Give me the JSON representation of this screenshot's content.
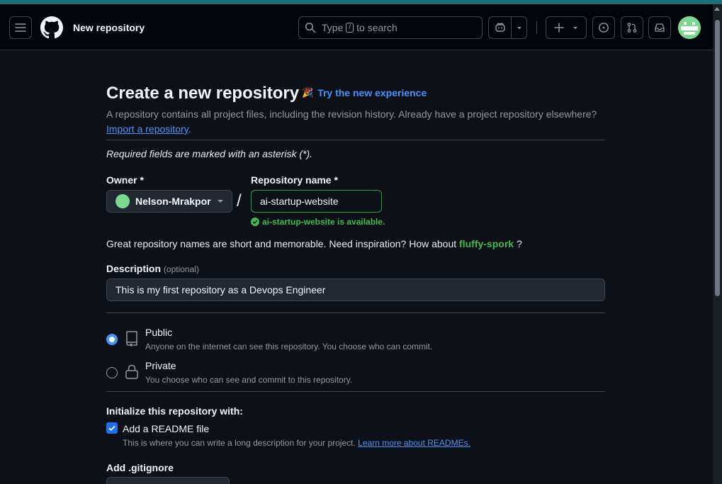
{
  "header": {
    "title": "New repository",
    "search_placeholder_prefix": "Type",
    "search_key": "/",
    "search_placeholder_suffix": "to search",
    "icons": [
      "hamburger-menu-icon",
      "github-logo-icon",
      "search-icon",
      "copilot-icon",
      "chevron-down-icon",
      "plus-icon",
      "issues-icon",
      "pull-requests-icon",
      "inbox-icon",
      "avatar"
    ]
  },
  "page": {
    "title": "Create a new repository",
    "try_new": "Try the new experience",
    "subtitle": "A repository contains all project files, including the revision history. Already have a project repository elsewhere?",
    "import_link": "Import a repository",
    "import_suffix": ".",
    "required_note": "Required fields are marked with an asterisk (*)."
  },
  "form": {
    "owner_label": "Owner *",
    "owner_value": "Nelson-Mrakpor",
    "slash": "/",
    "repo_label": "Repository name *",
    "repo_value": "ai-startup-website",
    "availability": "ai-startup-website is available.",
    "inspiration_prefix": "Great repository names are short and memorable. Need inspiration? How about",
    "inspiration_suggestion": "fluffy-spork",
    "inspiration_suffix": "?",
    "description_label": "Description",
    "description_optional": "(optional)",
    "description_value": "This is my first repository as a Devops Engineer"
  },
  "visibility": {
    "public_title": "Public",
    "public_desc": "Anyone on the internet can see this repository. You choose who can commit.",
    "private_title": "Private",
    "private_desc": "You choose who can see and commit to this repository.",
    "selected": "Public"
  },
  "init": {
    "heading": "Initialize this repository with:",
    "readme_label": "Add a README file",
    "readme_checked": true,
    "readme_desc": "This is where you can write a long description for your project.",
    "readme_link": "Learn more about READMEs.",
    "gitignore_label": "Add .gitignore"
  },
  "colors": {
    "accent": "#4493f8",
    "success": "#3fb950",
    "background": "#0d1117"
  }
}
